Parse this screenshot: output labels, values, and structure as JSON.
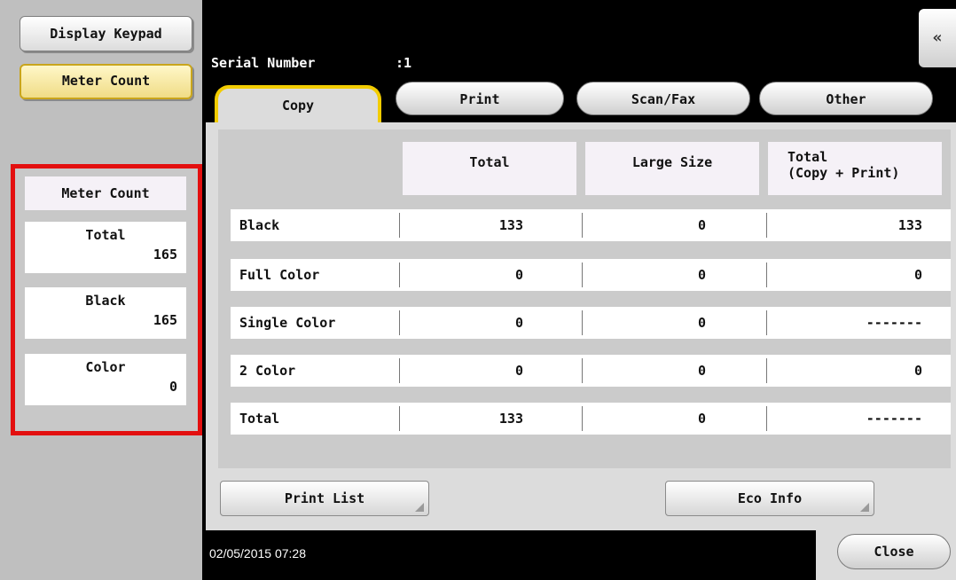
{
  "sidebar": {
    "display_keypad": "Display Keypad",
    "meter_count_button": "Meter Count",
    "meter_count": {
      "title": "Meter Count",
      "items": [
        {
          "label": "Total",
          "value": "165"
        },
        {
          "label": "Black",
          "value": "165"
        },
        {
          "label": "Color",
          "value": "0"
        }
      ]
    }
  },
  "header": {
    "serial_label": "Serial Number",
    "serial_value": ":1",
    "collapse_icon": "«"
  },
  "tabs": [
    {
      "label": "Copy",
      "selected": true
    },
    {
      "label": "Print",
      "selected": false
    },
    {
      "label": "Scan/Fax",
      "selected": false
    },
    {
      "label": "Other",
      "selected": false
    }
  ],
  "table": {
    "columns": [
      "Total",
      "Large Size",
      "Total\n(Copy + Print)"
    ],
    "rows": [
      {
        "label": "Black",
        "cells": [
          "133",
          "0",
          "133"
        ]
      },
      {
        "label": "Full Color",
        "cells": [
          "0",
          "0",
          "0"
        ]
      },
      {
        "label": "Single Color",
        "cells": [
          "0",
          "0",
          "-------"
        ]
      },
      {
        "label": "2 Color",
        "cells": [
          "0",
          "0",
          "0"
        ]
      },
      {
        "label": "Total",
        "cells": [
          "133",
          "0",
          "-------"
        ]
      }
    ]
  },
  "buttons": {
    "print_list": "Print List",
    "eco_info": "Eco Info",
    "close": "Close"
  },
  "status": {
    "datetime": "02/05/2015   07:28"
  },
  "colors": {
    "highlight_border": "#e30f0f",
    "selected_tab_accent": "#f2cc00"
  }
}
